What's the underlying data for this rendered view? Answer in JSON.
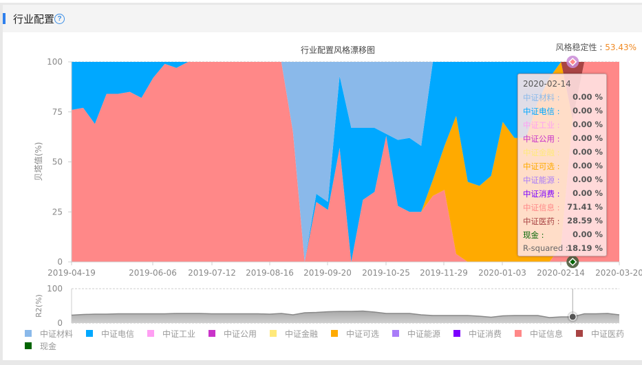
{
  "header": {
    "title": "行业配置",
    "help_icon": "question-circle-icon"
  },
  "stability": {
    "label": "风格稳定性 : ",
    "value": "53.43%"
  },
  "tooltip": {
    "date": "2020-02-14",
    "rows": [
      {
        "label": "中证材料 :",
        "value": "0.00 %",
        "color": "#8ab9ea"
      },
      {
        "label": "中证电信 :",
        "value": "0.00 %",
        "color": "#00a8ff"
      },
      {
        "label": "中证工业 :",
        "value": "0.00 %",
        "color": "#ff9ff3"
      },
      {
        "label": "中证公用 :",
        "value": "0.00 %",
        "color": "#c933c9"
      },
      {
        "label": "中证金融 :",
        "value": "0.00 %",
        "color": "#ffe97a"
      },
      {
        "label": "中证可选 :",
        "value": "0.00 %",
        "color": "#ffaa00"
      },
      {
        "label": "中证能源 :",
        "value": "0.00 %",
        "color": "#a97cf8"
      },
      {
        "label": "中证消费 :",
        "value": "0.00 %",
        "color": "#7b00ff"
      },
      {
        "label": "中证信息 :",
        "value": "71.41 %",
        "color": "#ff8888"
      },
      {
        "label": "中证医药 :",
        "value": "28.59 %",
        "color": "#a84444"
      },
      {
        "label": "现金 :",
        "value": "0.00 %",
        "color": "#006400"
      },
      {
        "label": "R-squared :",
        "value": "18.19 %",
        "color": "#666666"
      }
    ]
  },
  "chart_data": [
    {
      "type": "area",
      "stacked": true,
      "title": "行业配置风格漂移图",
      "xlabel": "",
      "ylabel": "贝塔值(%)",
      "ylim": [
        0,
        100
      ],
      "yticks": [
        0,
        25,
        50,
        75,
        100
      ],
      "xticks": [
        "2019-04-19",
        "2019-06-06",
        "2019-07-12",
        "2019-08-16",
        "2019-09-20",
        "2019-10-25",
        "2019-11-29",
        "2020-01-03",
        "2020-02-14",
        "2020-03-20"
      ],
      "point_count": 48,
      "highlight_index": 43,
      "series": [
        {
          "name": "中证信息",
          "color": "#ff8888",
          "values": [
            76,
            77,
            69,
            84,
            84,
            85,
            82,
            92,
            99,
            97,
            100,
            100,
            100,
            100,
            100,
            100,
            100,
            100,
            100,
            65,
            0,
            30,
            26,
            57,
            0,
            31,
            35,
            63,
            28,
            25,
            25,
            33,
            36,
            4,
            0,
            0,
            0,
            0,
            0,
            0,
            0,
            0,
            8,
            71.41,
            100,
            100,
            100,
            100
          ]
        },
        {
          "name": "中证可选",
          "color": "#ffaa00",
          "values": [
            0,
            0,
            0,
            0,
            0,
            0,
            0,
            0,
            0,
            0,
            0,
            0,
            0,
            0,
            0,
            0,
            0,
            0,
            0,
            0,
            0,
            0,
            0,
            0,
            0,
            0,
            0,
            0,
            0,
            0,
            0,
            8,
            22,
            69,
            40,
            38,
            43,
            70,
            62,
            62,
            80,
            92,
            92,
            0,
            0,
            0,
            0,
            0
          ]
        },
        {
          "name": "中证电信",
          "color": "#00a8ff",
          "values": [
            24,
            23,
            31,
            16,
            16,
            15,
            18,
            8,
            1,
            3,
            0,
            0,
            0,
            0,
            0,
            0,
            0,
            0,
            0,
            0,
            0,
            4,
            4,
            36,
            67,
            36,
            32,
            1,
            33,
            37,
            33,
            59,
            42,
            27,
            60,
            62,
            57,
            30,
            38,
            38,
            20,
            8,
            0,
            0,
            0,
            0,
            0,
            0
          ]
        },
        {
          "name": "中证材料",
          "color": "#8ab9ea",
          "values": [
            0,
            0,
            0,
            0,
            0,
            0,
            0,
            0,
            0,
            0,
            0,
            0,
            0,
            0,
            0,
            0,
            0,
            0,
            0,
            35,
            100,
            66,
            70,
            7,
            33,
            33,
            33,
            36,
            39,
            38,
            42,
            0,
            0,
            0,
            0,
            0,
            0,
            0,
            0,
            0,
            0,
            0,
            0,
            0,
            0,
            0,
            0,
            0
          ]
        },
        {
          "name": "中证医药",
          "color": "#a84444",
          "values": [
            0,
            0,
            0,
            0,
            0,
            0,
            0,
            0,
            0,
            0,
            0,
            0,
            0,
            0,
            0,
            0,
            0,
            0,
            0,
            0,
            0,
            0,
            0,
            0,
            0,
            0,
            0,
            0,
            0,
            0,
            0,
            0,
            0,
            0,
            0,
            0,
            0,
            0,
            0,
            0,
            0,
            0,
            0,
            28.59,
            0,
            0,
            0,
            0
          ]
        },
        {
          "name": "中证工业",
          "color": "#ff9ff3",
          "values": []
        },
        {
          "name": "中证公用",
          "color": "#c933c9",
          "values": []
        },
        {
          "name": "中证金融",
          "color": "#ffe97a",
          "values": []
        },
        {
          "name": "中证能源",
          "color": "#a97cf8",
          "values": []
        },
        {
          "name": "中证消费",
          "color": "#7b00ff",
          "values": []
        },
        {
          "name": "现金",
          "color": "#006400",
          "values": []
        }
      ]
    },
    {
      "type": "area",
      "title": "",
      "ylabel": "R2(%)",
      "ylim": [
        0,
        100
      ],
      "yticks": [
        0,
        100
      ],
      "series": [
        {
          "name": "R2",
          "color": "#999999",
          "values": [
            23,
            25,
            26,
            26,
            27,
            27,
            27,
            27,
            27,
            28,
            28,
            28,
            27,
            27,
            27,
            27,
            27,
            26,
            28,
            24,
            30,
            31,
            33,
            34,
            34,
            35,
            32,
            28,
            28,
            28,
            24,
            22,
            22,
            22,
            22,
            20,
            17,
            21,
            22,
            22,
            22,
            16,
            18,
            18.19,
            27,
            27,
            28,
            24
          ]
        }
      ]
    }
  ],
  "legend": [
    {
      "label": "中证材料",
      "color": "#8ab9ea"
    },
    {
      "label": "中证电信",
      "color": "#00a8ff"
    },
    {
      "label": "中证工业",
      "color": "#ff9ff3"
    },
    {
      "label": "中证公用",
      "color": "#c933c9"
    },
    {
      "label": "中证金融",
      "color": "#ffe97a"
    },
    {
      "label": "中证可选",
      "color": "#ffaa00"
    },
    {
      "label": "中证能源",
      "color": "#a97cf8"
    },
    {
      "label": "中证消费",
      "color": "#7b00ff"
    },
    {
      "label": "中证信息",
      "color": "#ff8888"
    },
    {
      "label": "中证医药",
      "color": "#a84444"
    },
    {
      "label": "现金",
      "color": "#006400"
    }
  ]
}
